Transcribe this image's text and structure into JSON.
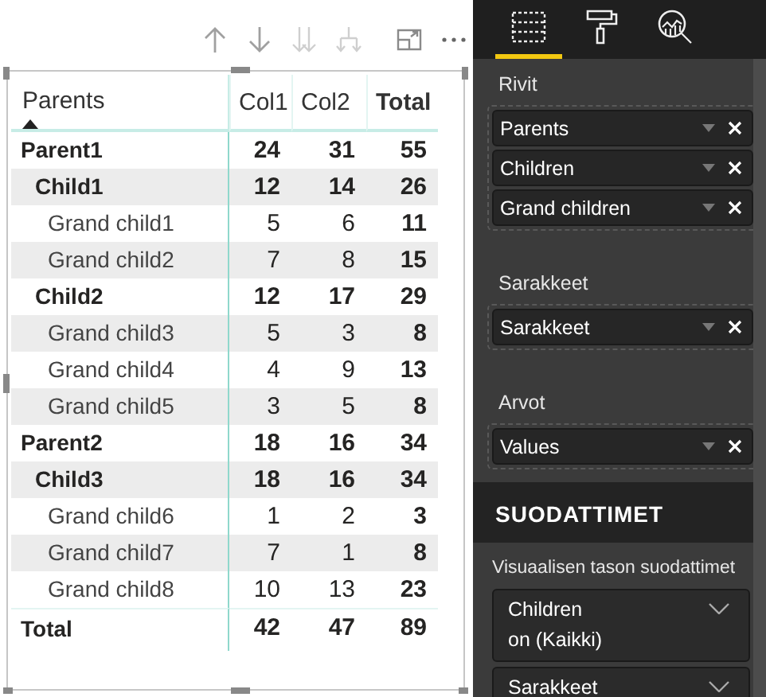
{
  "visual_toolbar": [
    {
      "kind": "up"
    },
    {
      "kind": "down"
    },
    {
      "kind": "double-down"
    },
    {
      "kind": "expand-down"
    },
    {
      "kind": "focus"
    },
    {
      "kind": "more"
    }
  ],
  "table": {
    "columns": [
      "Parents",
      "Col1",
      "Col2",
      "Total"
    ],
    "sorted_ascending": true,
    "rows": [
      {
        "label": "Parent1",
        "values": [
          "24",
          "31",
          "55"
        ],
        "children": [
          {
            "label": "Child1",
            "values": [
              "12",
              "14",
              "26"
            ],
            "children": [
              {
                "label": "Grand child1",
                "values": [
                  "5",
                  "6",
                  "11"
                ]
              },
              {
                "label": "Grand child2",
                "values": [
                  "7",
                  "8",
                  "15"
                ]
              }
            ]
          },
          {
            "label": "Child2",
            "values": [
              "12",
              "17",
              "29"
            ],
            "children": [
              {
                "label": "Grand child3",
                "values": [
                  "5",
                  "3",
                  "8"
                ]
              },
              {
                "label": "Grand child4",
                "values": [
                  "4",
                  "9",
                  "13"
                ]
              },
              {
                "label": "Grand child5",
                "values": [
                  "3",
                  "5",
                  "8"
                ]
              }
            ]
          }
        ]
      },
      {
        "label": "Parent2",
        "values": [
          "18",
          "16",
          "34"
        ],
        "children": [
          {
            "label": "Child3",
            "values": [
              "18",
              "16",
              "34"
            ],
            "children": [
              {
                "label": "Grand child6",
                "values": [
                  "1",
                  "2",
                  "3"
                ]
              },
              {
                "label": "Grand child7",
                "values": [
                  "7",
                  "1",
                  "8"
                ]
              },
              {
                "label": "Grand child8",
                "values": [
                  "10",
                  "13",
                  "23"
                ]
              }
            ]
          }
        ]
      }
    ],
    "total": {
      "label": "Total",
      "values": [
        "42",
        "47",
        "89"
      ]
    }
  },
  "pane_tabs": [
    {
      "kind": "fields",
      "selected": true
    },
    {
      "kind": "format",
      "selected": false
    },
    {
      "kind": "analytics",
      "selected": false
    }
  ],
  "wells": [
    {
      "title": "Rivit",
      "fields": [
        "Parents",
        "Children",
        "Grand children"
      ]
    },
    {
      "title": "Sarakkeet",
      "fields": [
        "Sarakkeet"
      ]
    },
    {
      "title": "Arvot",
      "fields": [
        "Values"
      ]
    }
  ],
  "filters": {
    "title": "SUODATTIMET",
    "section": "Visuaalisen tason suodattimet",
    "cards": [
      {
        "field": "Children",
        "condition": "on (Kaikki)"
      },
      {
        "field": "Sarakkeet"
      }
    ]
  }
}
